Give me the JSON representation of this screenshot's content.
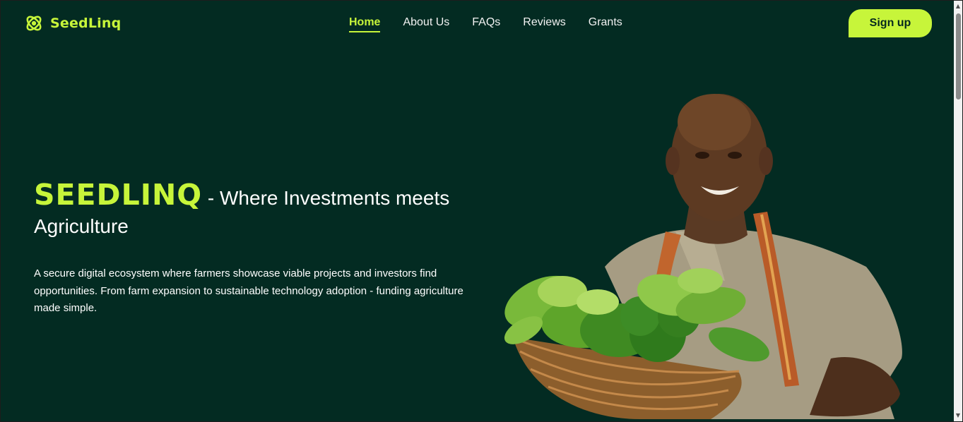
{
  "header": {
    "brand": "SeedLinq",
    "nav": [
      {
        "label": "Home",
        "active": true
      },
      {
        "label": "About Us",
        "active": false
      },
      {
        "label": "FAQs",
        "active": false
      },
      {
        "label": "Reviews",
        "active": false
      },
      {
        "label": "Grants",
        "active": false
      }
    ],
    "signup_label": "Sign up"
  },
  "hero": {
    "brand_word": "SEEDLINQ",
    "title_rest": " - Where Investments meets Agriculture",
    "description": "A secure digital ecosystem where farmers showcase viable projects and investors find opportunities. From farm expansion to sustainable technology adoption - funding agriculture made simple."
  },
  "colors": {
    "background": "#032b22",
    "accent": "#c7f53a"
  },
  "icons": {
    "logo": "atom-seed-icon",
    "scroll_up": "arrow-up-icon",
    "scroll_down": "arrow-down-icon"
  }
}
